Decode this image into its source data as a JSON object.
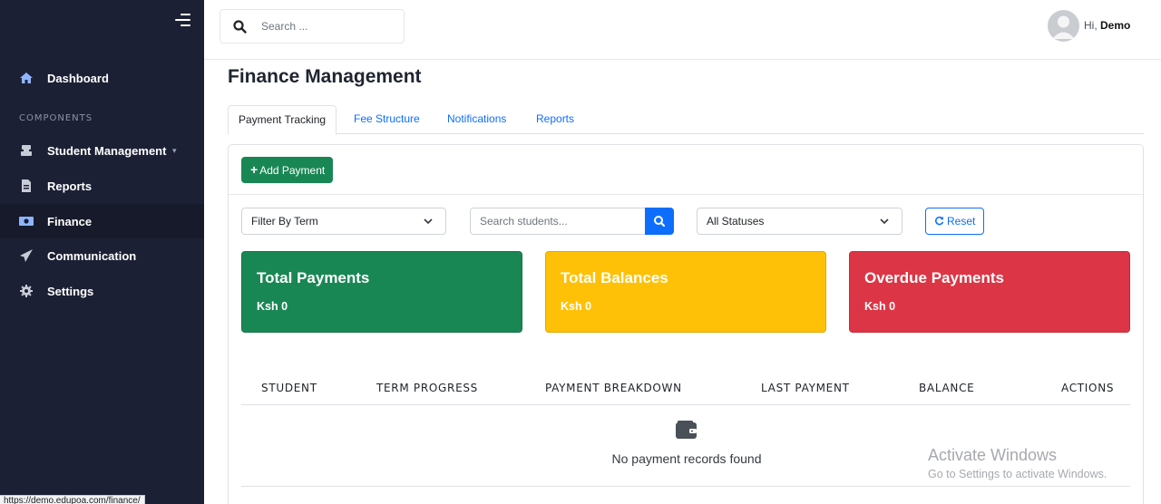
{
  "sidebar": {
    "section_label": "COMPONENTS",
    "items": [
      {
        "label": "Dashboard",
        "icon": "home-icon"
      },
      {
        "label": "Student Management",
        "icon": "student-icon"
      },
      {
        "label": "Reports",
        "icon": "file-icon"
      },
      {
        "label": "Finance",
        "icon": "money-icon"
      },
      {
        "label": "Communication",
        "icon": "paper-plane-icon"
      },
      {
        "label": "Settings",
        "icon": "gear-icon"
      }
    ],
    "active": "Finance"
  },
  "header": {
    "search_placeholder": "Search ...",
    "greeting_prefix": "Hi, ",
    "user_name": "Demo"
  },
  "main": {
    "title": "Finance Management",
    "tabs": [
      {
        "label": "Payment Tracking",
        "active": true
      },
      {
        "label": "Fee Structure",
        "active": false
      },
      {
        "label": "Notifications",
        "active": false
      },
      {
        "label": "Reports",
        "active": false
      }
    ],
    "add_button_label": "Add Payment",
    "filters": {
      "term_select": "Filter By Term",
      "student_search_placeholder": "Search students...",
      "status_select": "All Statuses",
      "reset_label": "Reset"
    },
    "stats": [
      {
        "title": "Total Payments",
        "value": "Ksh 0",
        "color": "#198754"
      },
      {
        "title": "Total Balances",
        "value": "Ksh 0",
        "color": "#ffc107"
      },
      {
        "title": "Overdue Payments",
        "value": "Ksh 0",
        "color": "#dc3545"
      }
    ],
    "table": {
      "columns": [
        "STUDENT",
        "TERM PROGRESS",
        "PAYMENT BREAKDOWN",
        "LAST PAYMENT",
        "BALANCE",
        "ACTIONS"
      ],
      "empty_text": "No payment records found",
      "empty_icon": "wallet-icon"
    }
  },
  "overlay": {
    "watermark_line1": "Activate Windows",
    "watermark_line2": "Go to Settings to activate Windows.",
    "status_url": "https://demo.edupoa.com/finance/"
  },
  "colors": {
    "sidebar_bg": "#1c2034",
    "primary": "#0d6efd",
    "success": "#198754",
    "warning": "#ffc107",
    "danger": "#dc3545"
  }
}
